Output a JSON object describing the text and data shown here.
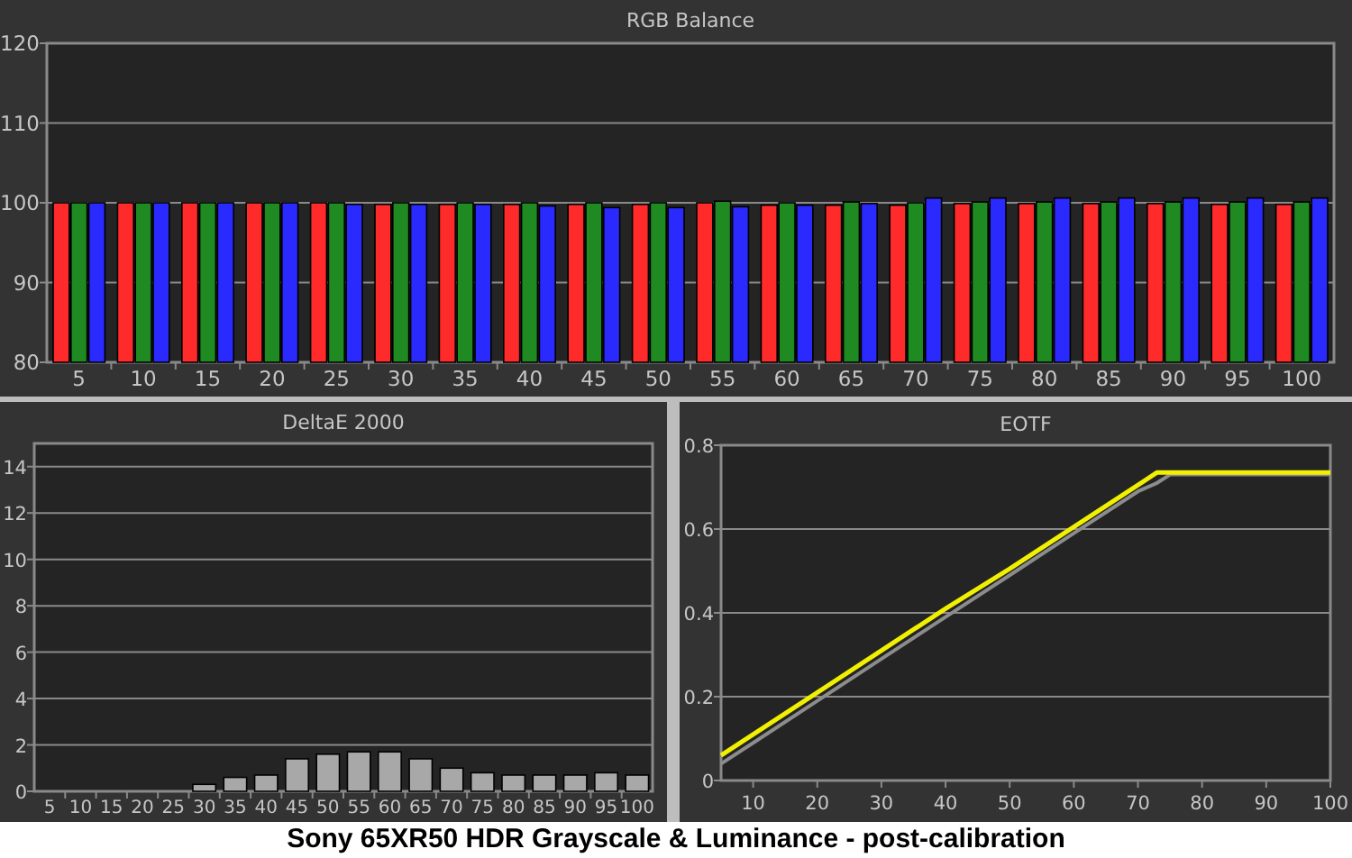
{
  "charts": [
    {
      "chart_data": {
        "type": "bar",
        "title": "RGB Balance",
        "grid": true,
        "categories": [
          "5",
          "10",
          "15",
          "20",
          "25",
          "30",
          "35",
          "40",
          "45",
          "50",
          "55",
          "60",
          "65",
          "70",
          "75",
          "80",
          "85",
          "90",
          "95",
          "100"
        ],
        "ylim": [
          80,
          120
        ],
        "yticks": [
          80,
          90,
          100,
          110,
          120
        ],
        "series": [
          {
            "color": "#ff2a2a",
            "values": [
              100,
              100,
              100,
              100,
              100,
              99.8,
              99.8,
              99.8,
              99.8,
              99.8,
              100,
              99.7,
              99.7,
              99.7,
              99.9,
              99.9,
              99.9,
              99.9,
              99.8,
              99.8
            ]
          },
          {
            "color": "#1f8a22",
            "values": [
              100,
              100,
              100,
              100,
              100,
              100,
              100,
              100,
              100,
              100,
              100.2,
              100,
              100.1,
              100,
              100.1,
              100.1,
              100.1,
              100.1,
              100.1,
              100.1
            ]
          },
          {
            "color": "#2a2aff",
            "values": [
              100,
              100,
              100,
              100,
              99.8,
              99.8,
              99.8,
              99.6,
              99.4,
              99.4,
              99.5,
              99.7,
              99.9,
              100.6,
              100.6,
              100.6,
              100.6,
              100.6,
              100.6,
              100.6
            ]
          }
        ]
      }
    },
    {
      "chart_data": {
        "type": "bar",
        "title": "DeltaE 2000",
        "grid": true,
        "categories": [
          "5",
          "10",
          "15",
          "20",
          "25",
          "30",
          "35",
          "40",
          "45",
          "50",
          "55",
          "60",
          "65",
          "70",
          "75",
          "80",
          "85",
          "90",
          "95",
          "100"
        ],
        "ylim": [
          0,
          15
        ],
        "yticks": [
          0,
          2,
          4,
          6,
          8,
          10,
          12,
          14
        ],
        "series": [
          {
            "color": "#a8a8a8",
            "values": [
              0,
              0,
              0,
              0,
              0,
              0.3,
              0.6,
              0.7,
              1.4,
              1.6,
              1.7,
              1.7,
              1.4,
              1.0,
              0.8,
              0.7,
              0.7,
              0.7,
              0.8,
              0.7
            ]
          }
        ]
      }
    },
    {
      "chart_data": {
        "type": "line",
        "title": "EOTF",
        "grid": true,
        "x": [
          5,
          10,
          20,
          30,
          40,
          50,
          60,
          70,
          73,
          75,
          80,
          90,
          100
        ],
        "xlim": [
          5,
          100
        ],
        "ylim": [
          0,
          0.8
        ],
        "xticks": [
          10,
          20,
          30,
          40,
          50,
          60,
          70,
          80,
          90,
          100
        ],
        "yticks": [
          {
            "value": 0,
            "label": "0"
          },
          0.2,
          0.4,
          0.6,
          0.8
        ],
        "series": [
          {
            "color": "#8c8c8c",
            "values": [
              0.04,
              0.09,
              0.19,
              0.29,
              0.39,
              0.49,
              0.59,
              0.69,
              0.71,
              0.73,
              0.73,
              0.73,
              0.73
            ]
          },
          {
            "color": "#f0f000",
            "values": [
              0.06,
              0.11,
              0.21,
              0.31,
              0.41,
              0.505,
              0.605,
              0.705,
              0.735,
              0.735,
              0.735,
              0.735,
              0.735
            ]
          }
        ]
      }
    }
  ],
  "caption": "Sony 65XR50 HDR Grayscale & Luminance - post-calibration"
}
